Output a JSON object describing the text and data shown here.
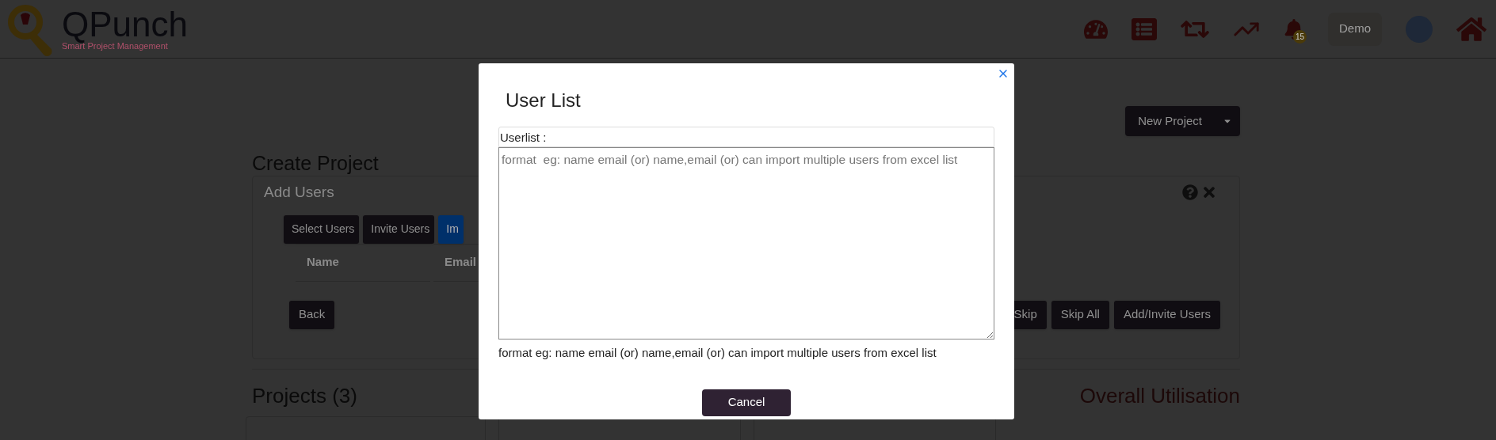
{
  "header": {
    "logo": {
      "name": "QPunch",
      "tagline": "Smart Project Management"
    },
    "notifications_badge": "15",
    "user_button": "Demo"
  },
  "new_project_button": "New Project",
  "page_title": "Create Project",
  "add_users_card": {
    "title": "Add Users",
    "tabs": [
      {
        "label": "Select Users",
        "selected": false
      },
      {
        "label": "Invite Users",
        "selected": false
      },
      {
        "label": "Im",
        "selected": true
      }
    ],
    "table": {
      "columns": [
        "Name",
        "Email"
      ]
    },
    "buttons_left": [
      "Back"
    ],
    "buttons_right": [
      "Skip",
      "Skip All",
      "Add/Invite Users"
    ]
  },
  "projects_heading": "Projects (3)",
  "utilisation_heading": "Overall Utilisation",
  "dialog": {
    "title": "User List",
    "field_label": "Userlist :",
    "placeholder": "format  eg: name email (or) name,email (or) can import multiple users from excel list",
    "hint": "format eg: name email (or) name,email (or) can import multiple users from excel list",
    "buttons": [
      "Cancel"
    ]
  }
}
